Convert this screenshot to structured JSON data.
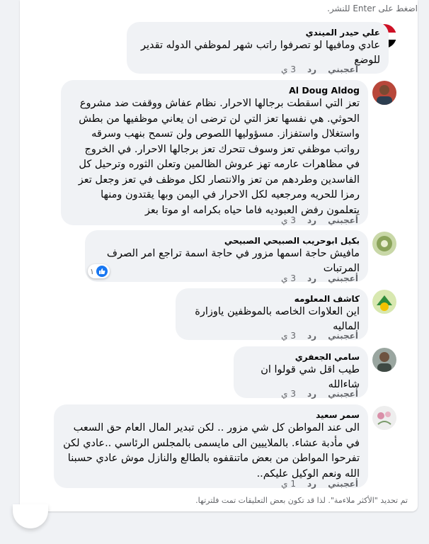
{
  "hint": "اضغط على Enter للنشر.",
  "comments": [
    {
      "author": "علي حيدر الميندي",
      "text": "عادي ومافيها لو تصرفوا راتب شهر لموظفي الدوله تقدير للوضع",
      "like_label": "أعجبني",
      "reply_label": "رد",
      "time": "3 ي"
    },
    {
      "author": "Al Doug Aldog",
      "text": "تعز التي اسقطت برجالها الاحرار. نظام عفاش ووقفت ضد مشروع الحوثي. هي نفسها تعز التي لن ترضى ان يعاني موظفيها من بطش واستغلال واستفزاز. مسؤوليها اللصوص ولن تسمح بنهب وسرقه رواتب موظفي تعز وسوف تتحرك تعز برجالها الاحرار. في الخروج في مظاهرات عارمه تهز عروش الظالمين وتعلن الثوره وترحيل كل الفاسدين وطردهم من تعز والانتصار لكل موظف في تعز وجعل تعز رمزا للحريه ومرجعيه لكل الاحرار في اليمن وبها يقتدون ومنها يتعلمون رفض العبوديه فاما حياه بكرامه او موتا بعز",
      "like_label": "أعجبني",
      "reply_label": "رد",
      "time": "3 ي"
    },
    {
      "author": "بكيل ابوحريب الصبيحي الصبيحي",
      "text": "مافيش حاجة اسمها مزور في حاجة اسمة تراجع امر الصرف المرتبات",
      "like_label": "أعجبني",
      "reply_label": "رد",
      "time": "3 ي",
      "reaction_count": "١"
    },
    {
      "author": "كاشف المعلومه",
      "text": "اين العلاوات الخاصه بالموظفين ياوزارة الماليه",
      "like_label": "أعجبني",
      "reply_label": "رد",
      "time": "3 ي"
    },
    {
      "author": "سامي الجعفري",
      "text": "طيب اقل شي قولوا ان شاءالله",
      "like_label": "أعجبني",
      "reply_label": "رد",
      "time": "3 ي"
    },
    {
      "author": "سمر سعيد",
      "text": "الى عند المواطن كل شي مزور .. لكن تبدير المال العام حق السعب في مأدبة عشاء. بالملاييين الى مايسمى بالمجلس الرئاسي ..عادي لكن تفرحوا المواطن من بعض ماتنقفوه بالطالع والنازل موش عادي حسبنا الله ونعم الوكيل عليكم..",
      "like_label": "أعجبني",
      "reply_label": "رد",
      "time": "1 ي"
    }
  ],
  "footer_note": "تم تحديد \"الأكثر ملاءمة\". لذا قد تكون بعض التعليقات تمت فلترتها."
}
